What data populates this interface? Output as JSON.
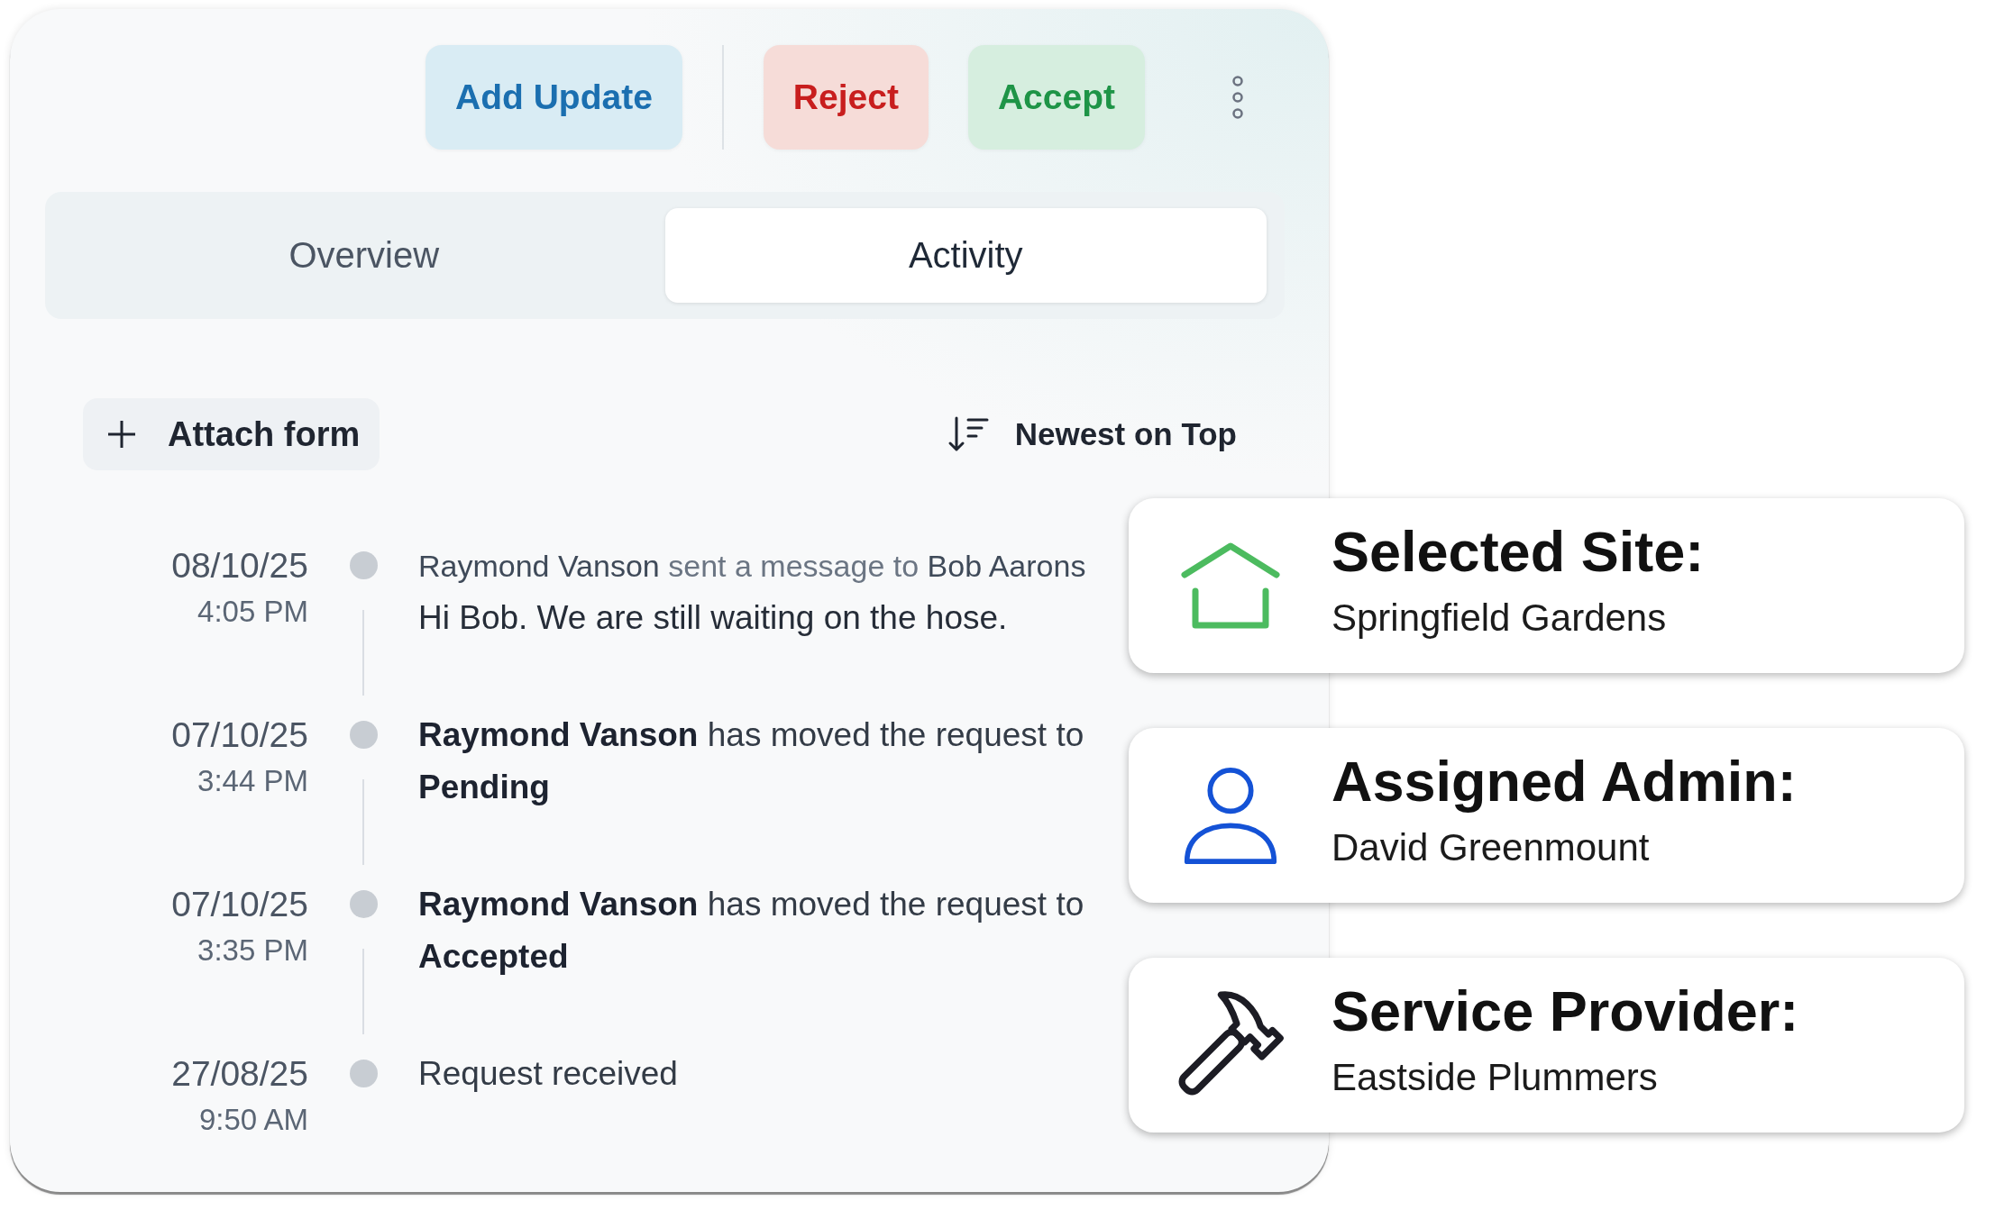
{
  "header_actions": [
    {
      "label": "Add Update",
      "kind": "info"
    },
    {
      "label": "Reject",
      "kind": "danger"
    },
    {
      "label": "Accept",
      "kind": "success"
    }
  ],
  "tabs": [
    {
      "label": "Overview",
      "selected": false
    },
    {
      "label": "Activity",
      "selected": true
    }
  ],
  "toolbar": {
    "attach_button": "Attach form",
    "sort_button": "Newest on Top"
  },
  "timeline": [
    {
      "kind": "message",
      "date": "08/10/25",
      "time": "4:05 PM",
      "sender": "Raymond Vanson",
      "action": "sent a message to",
      "recipient": "Bob Aarons",
      "message": "Hi Bob. We are still waiting on the hose."
    },
    {
      "kind": "update",
      "date": "07/10/25",
      "time": "3:44 PM",
      "text": "**Raymond Vanson** has moved the request to **Pending**"
    },
    {
      "kind": "update",
      "date": "07/10/25",
      "time": "3:35 PM",
      "text": "**Raymond Vanson** has moved the request to **Accepted**"
    },
    {
      "kind": "update",
      "date": "27/08/25",
      "time": "9:50 AM",
      "text": "Request received"
    }
  ],
  "info_cards": [
    {
      "kind": "site",
      "title": "Selected Site:",
      "value": "Springfield Gardens"
    },
    {
      "kind": "admin",
      "title": "Assigned Admin:",
      "value": "David Greenmount"
    },
    {
      "kind": "provider",
      "title": "Service Provider:",
      "value": "Eastside Plummers"
    }
  ]
}
